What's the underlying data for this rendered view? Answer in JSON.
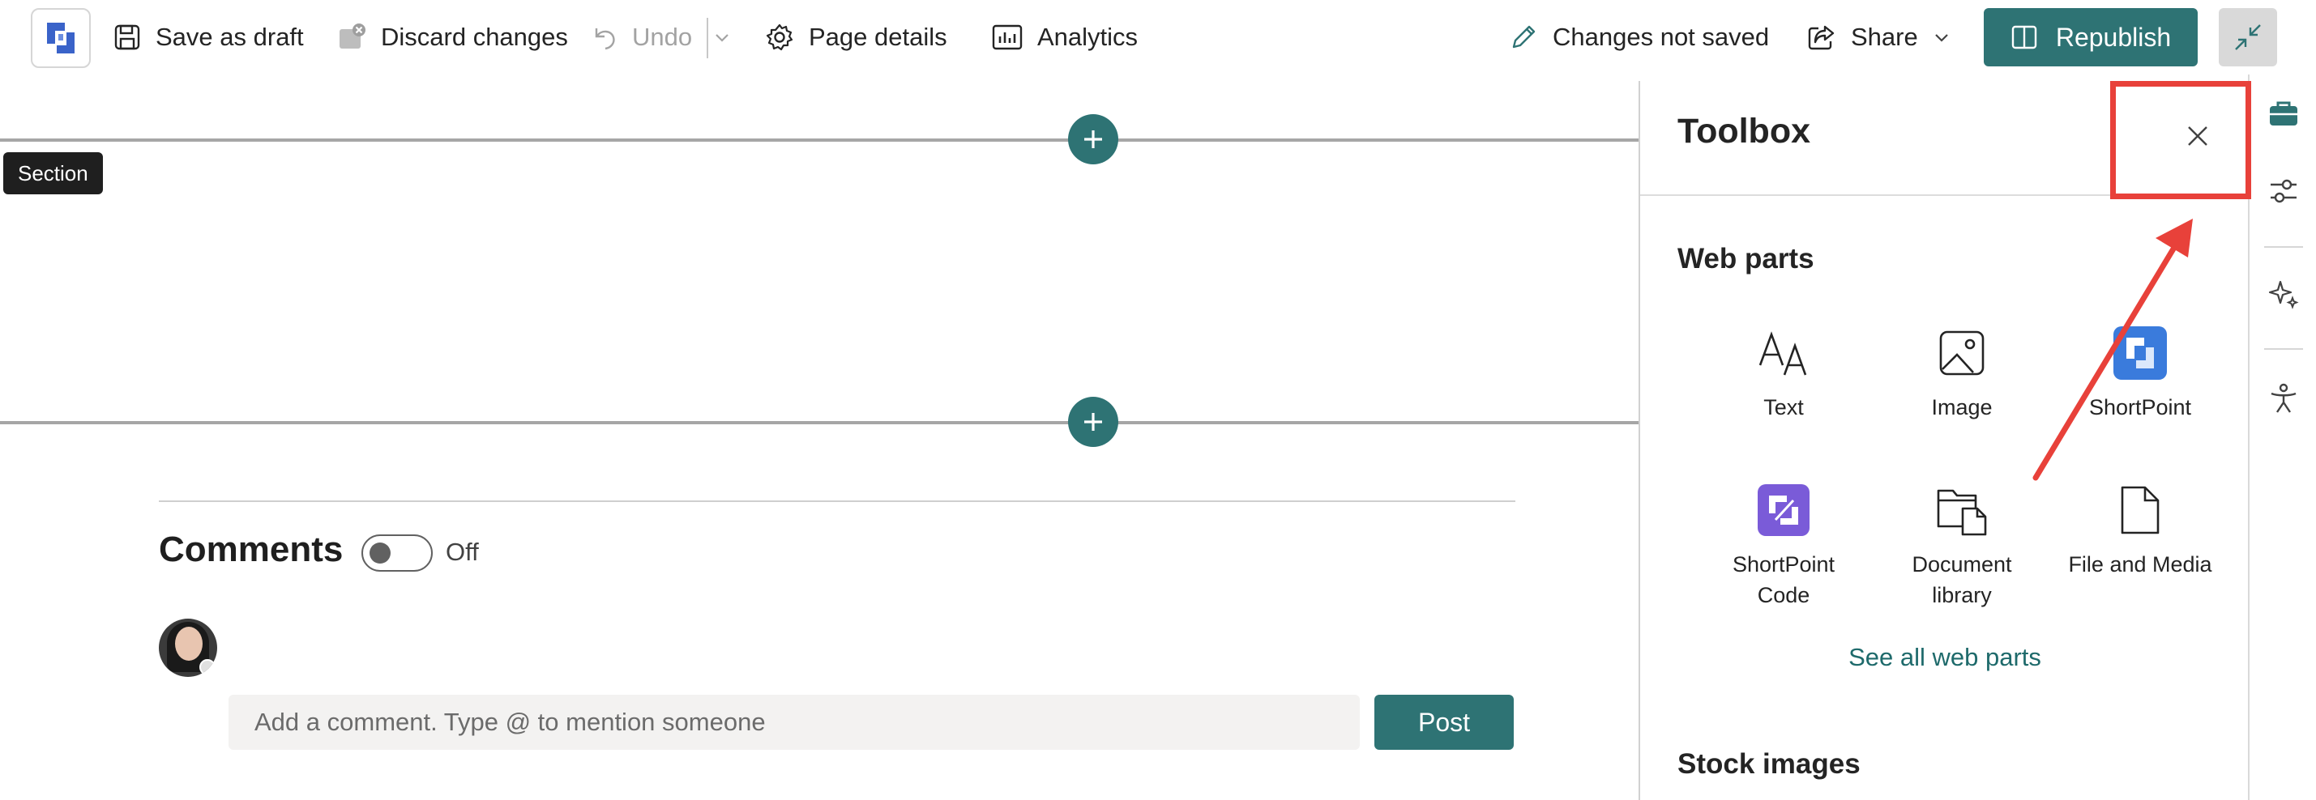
{
  "toolbar": {
    "save_draft": "Save as draft",
    "discard": "Discard changes",
    "undo": "Undo",
    "page_details": "Page details",
    "analytics": "Analytics",
    "status": "Changes not saved",
    "share": "Share",
    "republish": "Republish"
  },
  "canvas": {
    "tooltip": "Section",
    "comments_title": "Comments",
    "toggle_state": "Off",
    "comment_placeholder": "Add a comment. Type @ to mention someone",
    "post": "Post"
  },
  "toolbox": {
    "title": "Toolbox",
    "web_parts_heading": "Web parts",
    "web_parts": [
      {
        "label": "Text",
        "icon": "text-icon"
      },
      {
        "label": "Image",
        "icon": "image-icon"
      },
      {
        "label": "ShortPoint",
        "icon": "shortpoint-icon"
      },
      {
        "label": "ShortPoint Code",
        "icon": "shortpoint-code-icon"
      },
      {
        "label": "Document library",
        "icon": "document-library-icon"
      },
      {
        "label": "File and Media",
        "icon": "file-icon"
      }
    ],
    "see_all": "See all web parts",
    "stock_heading": "Stock images"
  },
  "colors": {
    "accent": "#2e7374",
    "annotation": "#e8413a",
    "shortpoint_blue": "#3a7bdc",
    "shortpoint_purple": "#7a5bd8"
  }
}
